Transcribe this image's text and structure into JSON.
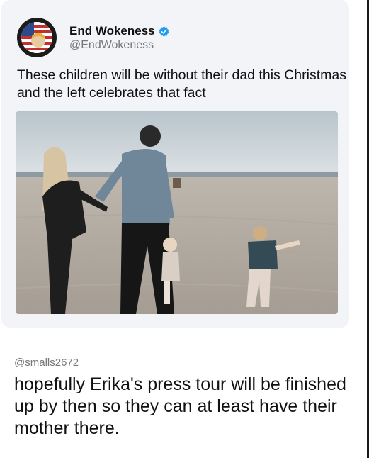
{
  "tweet": {
    "display_name": "End Wokeness",
    "handle": "@EndWokeness",
    "text": "These children will be without their dad this Christmas and the left celebrates that fact",
    "avatar_icon": "flag-seal-avatar",
    "badge_icon": "verified-badge-icon",
    "badge_color": "#1d9bf0",
    "avatar_text_top": "I SUPPORT THE",
    "avatar_text_bottom": "FORMER PRESIDENT"
  },
  "reply": {
    "handle": "@smalls2672",
    "text": "hopefully Erika's press tour will be finished up by then so they can at least have their mother there."
  },
  "colors": {
    "card_background": "#f2f4f8",
    "text_primary": "#111111",
    "text_secondary": "#777777"
  }
}
